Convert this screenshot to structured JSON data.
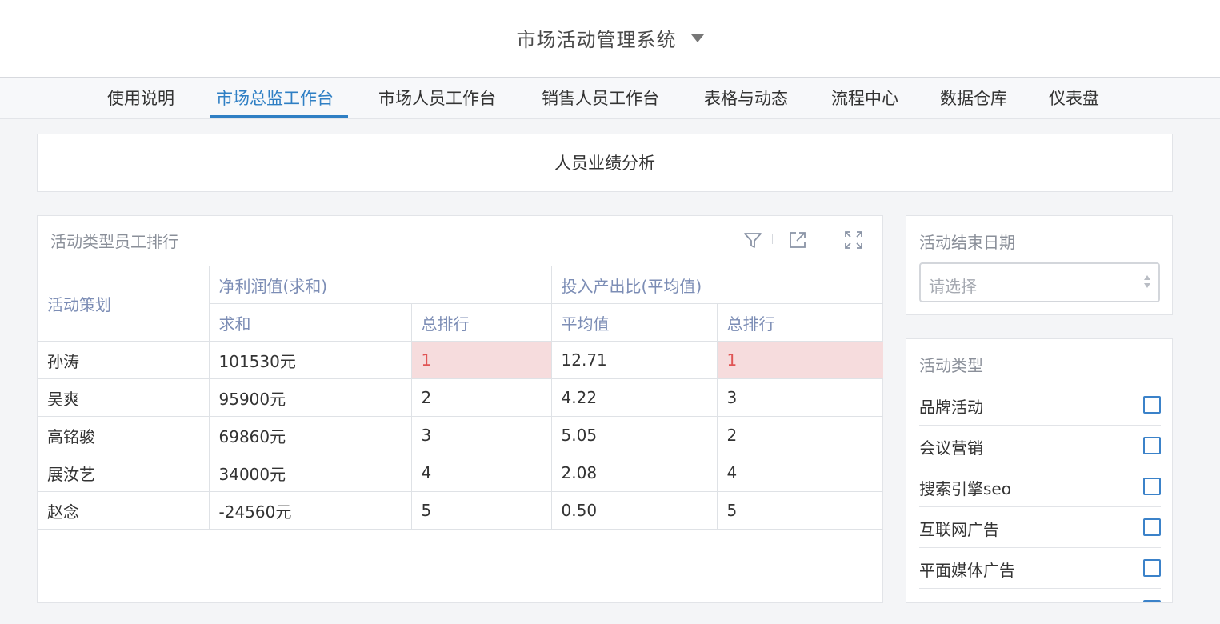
{
  "header": {
    "title": "市场活动管理系统"
  },
  "nav": {
    "tabs": [
      {
        "label": "使用说明",
        "active": false
      },
      {
        "label": "市场总监工作台",
        "active": true
      },
      {
        "label": "市场人员工作台",
        "active": false
      },
      {
        "label": "销售人员工作台",
        "active": false
      },
      {
        "label": "表格与动态",
        "active": false
      },
      {
        "label": "流程中心",
        "active": false
      },
      {
        "label": "数据仓库",
        "active": false
      },
      {
        "label": "仪表盘",
        "active": false
      }
    ]
  },
  "section": {
    "title": "人员业绩分析"
  },
  "panel": {
    "title": "活动类型员工排行",
    "icons": [
      "filter-icon",
      "export-icon",
      "fullscreen-icon"
    ],
    "table": {
      "corner_header": "活动策划",
      "group_headers": [
        "净利润值(求和)",
        "投入产出比(平均值)"
      ],
      "sub_headers": [
        "求和",
        "总排行",
        "平均值",
        "总排行"
      ],
      "rows": [
        {
          "name": "孙涛",
          "sum": "101530元",
          "rank1": "1",
          "avg": "12.71",
          "rank2": "1"
        },
        {
          "name": "吴爽",
          "sum": "95900元",
          "rank1": "2",
          "avg": "4.22",
          "rank2": "3"
        },
        {
          "name": "高铭骏",
          "sum": "69860元",
          "rank1": "3",
          "avg": "5.05",
          "rank2": "2"
        },
        {
          "name": "展汝艺",
          "sum": "34000元",
          "rank1": "4",
          "avg": "2.08",
          "rank2": "4"
        },
        {
          "name": "赵念",
          "sum": "-24560元",
          "rank1": "5",
          "avg": "0.50",
          "rank2": "5"
        }
      ],
      "highlight_color": "#f6dcdd"
    }
  },
  "filters": {
    "end_date": {
      "label": "活动结束日期",
      "placeholder": "请选择"
    },
    "activity_type": {
      "label": "活动类型",
      "options": [
        "品牌活动",
        "会议营销",
        "搜索引擎seo",
        "互联网广告",
        "平面媒体广告"
      ]
    }
  },
  "colors": {
    "accent": "#2f7fc4",
    "header_text": "#7c8db5",
    "checkbox": "#3b82c9"
  }
}
